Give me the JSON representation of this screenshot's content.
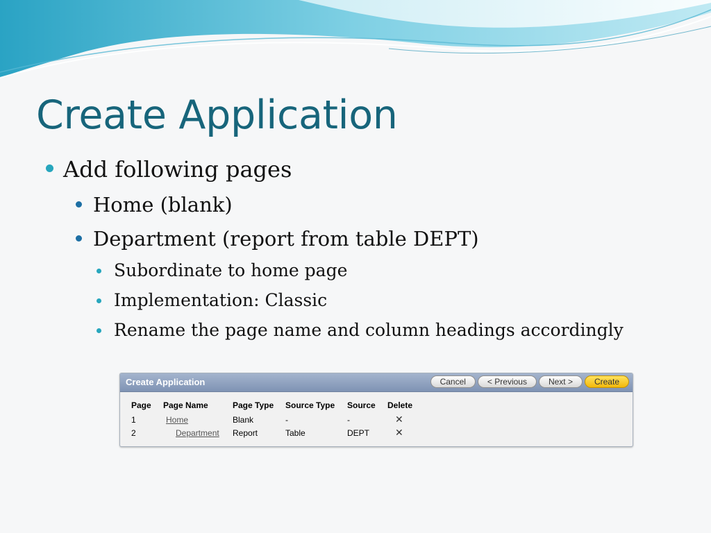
{
  "slide": {
    "title": "Create Application",
    "bullets": {
      "b1": "Add following pages",
      "b2": "Home (blank)",
      "b3": "Department (report from table DEPT)",
      "b4": "Subordinate to home page",
      "b5": "Implementation: Classic",
      "b6": "Rename the page name and column headings accordingly"
    }
  },
  "wizard": {
    "title": "Create Application",
    "buttons": {
      "cancel": "Cancel",
      "previous": "< Previous",
      "next": "Next >",
      "create": "Create"
    },
    "headers": {
      "page": "Page",
      "page_name": "Page Name",
      "page_type": "Page Type",
      "source_type": "Source Type",
      "source": "Source",
      "delete": "Delete"
    },
    "rows": [
      {
        "page": "1",
        "page_name": "Home",
        "page_type": "Blank",
        "source_type": "-",
        "source": "-",
        "delete": "✕"
      },
      {
        "page": "2",
        "page_name": "Department",
        "page_type": "Report",
        "source_type": "Table",
        "source": "DEPT",
        "delete": "✕"
      }
    ]
  },
  "colors": {
    "title": "#17657b",
    "bullet_primary": "#27a6bd",
    "bullet_secondary": "#1d6fa4",
    "panel_header": "#8fa1bf",
    "create_button": "#f6c21c"
  }
}
